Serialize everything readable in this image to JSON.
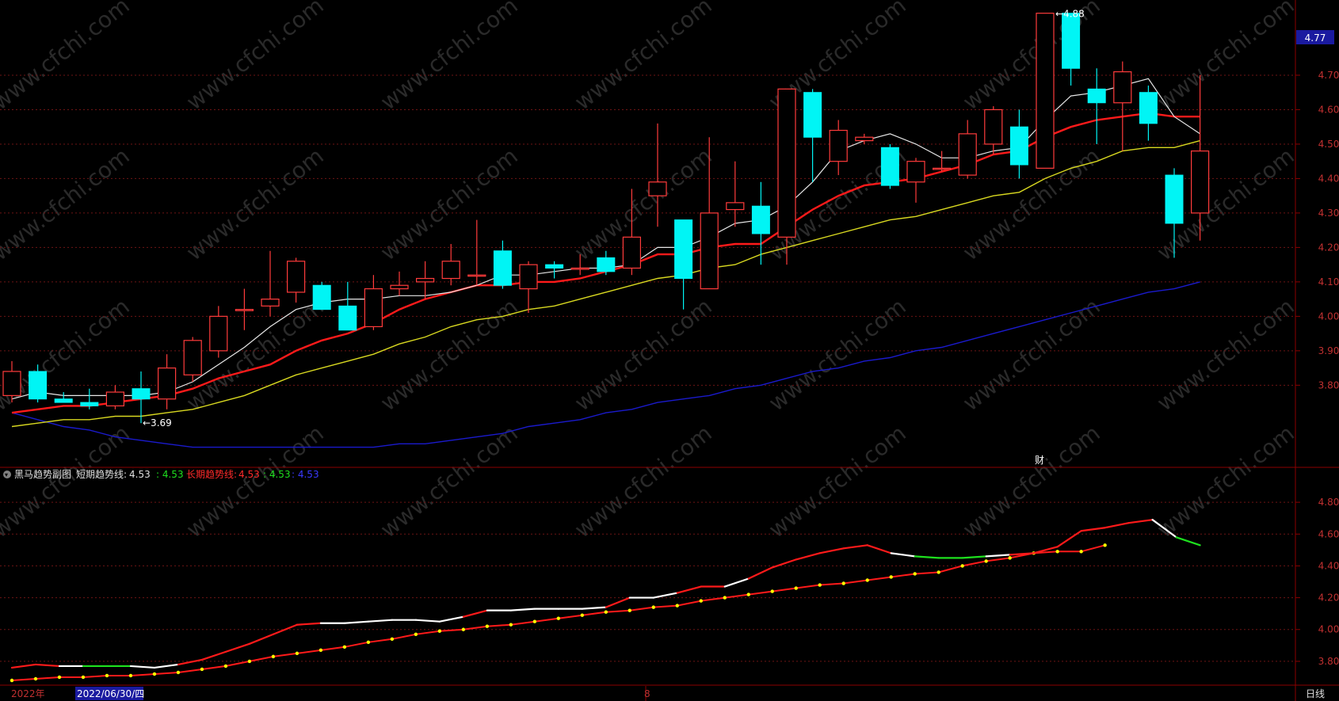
{
  "colors": {
    "bg": "#000000",
    "frame": "#8b0000",
    "grid": "#6e1414",
    "axis_text": "#c03030",
    "up": "#ff3b3b",
    "down": "#00f5f5",
    "ma_short": "#e6e6e6",
    "ma_mid": "#ff1a1a",
    "ma_long": "#d8d820",
    "ma_xlong": "#1a1acc",
    "sub_up": "#ff1a1a",
    "sub_flat": "#ffffff",
    "sub_down": "#1ee01e",
    "sub_dots": "#ffff00",
    "price_tag_bg": "#1a1aa0"
  },
  "watermark": "www.cfchi.com",
  "current_price_tag": "4.77",
  "main_panel": {
    "high_marker": "4.88",
    "low_marker": "3.69",
    "event_marker": "财"
  },
  "indicator_panel": {
    "collapse_icon": "chevron-down-icon",
    "title": "黑马趋势副图",
    "short_label": "短期趋势线:",
    "short_value": "4.53",
    "value_green": ": 4.53",
    "long_label": "长期趋势线:",
    "long_value": "4.53",
    "value_green2": ": 4.53",
    "value_blue": ": 4.53"
  },
  "time_axis": {
    "year_label": "2022年",
    "selected_date": "2022/06/30/四",
    "month_label": "8"
  },
  "period_button": "日线",
  "chart_data": [
    {
      "type": "candlestick",
      "y_axis_ticks": [
        "4.70",
        "4.60",
        "4.50",
        "4.40",
        "4.30",
        "4.20",
        "4.10",
        "4.00",
        "3.90",
        "3.80"
      ],
      "ylim": [
        3.58,
        4.9
      ],
      "candles": [
        {
          "o": 3.77,
          "h": 3.87,
          "l": 3.75,
          "c": 3.84
        },
        {
          "o": 3.84,
          "h": 3.86,
          "l": 3.75,
          "c": 3.76
        },
        {
          "o": 3.76,
          "h": 3.78,
          "l": 3.75,
          "c": 3.75
        },
        {
          "o": 3.75,
          "h": 3.79,
          "l": 3.73,
          "c": 3.74
        },
        {
          "o": 3.74,
          "h": 3.8,
          "l": 3.73,
          "c": 3.78
        },
        {
          "o": 3.79,
          "h": 3.84,
          "l": 3.69,
          "c": 3.76
        },
        {
          "o": 3.76,
          "h": 3.89,
          "l": 3.73,
          "c": 3.85
        },
        {
          "o": 3.83,
          "h": 3.94,
          "l": 3.81,
          "c": 3.93
        },
        {
          "o": 3.9,
          "h": 4.03,
          "l": 3.88,
          "c": 4.0
        },
        {
          "o": 4.02,
          "h": 4.08,
          "l": 3.96,
          "c": 4.02
        },
        {
          "o": 4.03,
          "h": 4.19,
          "l": 4.0,
          "c": 4.05
        },
        {
          "o": 4.07,
          "h": 4.17,
          "l": 4.04,
          "c": 4.16
        },
        {
          "o": 4.09,
          "h": 4.1,
          "l": 4.02,
          "c": 4.02
        },
        {
          "o": 4.03,
          "h": 4.1,
          "l": 3.98,
          "c": 3.96
        },
        {
          "o": 3.97,
          "h": 4.12,
          "l": 3.96,
          "c": 4.08
        },
        {
          "o": 4.08,
          "h": 4.13,
          "l": 4.06,
          "c": 4.09
        },
        {
          "o": 4.1,
          "h": 4.16,
          "l": 4.05,
          "c": 4.11
        },
        {
          "o": 4.11,
          "h": 4.21,
          "l": 4.09,
          "c": 4.16
        },
        {
          "o": 4.12,
          "h": 4.28,
          "l": 4.09,
          "c": 4.12
        },
        {
          "o": 4.19,
          "h": 4.22,
          "l": 4.08,
          "c": 4.09
        },
        {
          "o": 4.08,
          "h": 4.16,
          "l": 4.01,
          "c": 4.15
        },
        {
          "o": 4.15,
          "h": 4.16,
          "l": 4.11,
          "c": 4.14
        },
        {
          "o": 4.14,
          "h": 4.18,
          "l": 4.12,
          "c": 4.14
        },
        {
          "o": 4.17,
          "h": 4.19,
          "l": 4.12,
          "c": 4.13
        },
        {
          "o": 4.14,
          "h": 4.37,
          "l": 4.12,
          "c": 4.23
        },
        {
          "o": 4.35,
          "h": 4.56,
          "l": 4.26,
          "c": 4.39
        },
        {
          "o": 4.28,
          "h": 4.28,
          "l": 4.02,
          "c": 4.11
        },
        {
          "o": 4.08,
          "h": 4.52,
          "l": 4.08,
          "c": 4.3
        },
        {
          "o": 4.31,
          "h": 4.45,
          "l": 4.26,
          "c": 4.33
        },
        {
          "o": 4.32,
          "h": 4.39,
          "l": 4.15,
          "c": 4.24
        },
        {
          "o": 4.23,
          "h": 4.66,
          "l": 4.15,
          "c": 4.66
        },
        {
          "o": 4.65,
          "h": 4.66,
          "l": 4.39,
          "c": 4.52
        },
        {
          "o": 4.45,
          "h": 4.57,
          "l": 4.41,
          "c": 4.54
        },
        {
          "o": 4.51,
          "h": 4.53,
          "l": 4.5,
          "c": 4.52
        },
        {
          "o": 4.49,
          "h": 4.5,
          "l": 4.37,
          "c": 4.38
        },
        {
          "o": 4.39,
          "h": 4.46,
          "l": 4.33,
          "c": 4.45
        },
        {
          "o": 4.43,
          "h": 4.48,
          "l": 4.42,
          "c": 4.43
        },
        {
          "o": 4.41,
          "h": 4.57,
          "l": 4.4,
          "c": 4.53
        },
        {
          "o": 4.5,
          "h": 4.61,
          "l": 4.47,
          "c": 4.6
        },
        {
          "o": 4.55,
          "h": 4.6,
          "l": 4.4,
          "c": 4.44
        },
        {
          "o": 4.43,
          "h": 4.88,
          "l": 4.43,
          "c": 4.88
        },
        {
          "o": 4.88,
          "h": 4.88,
          "l": 4.67,
          "c": 4.72
        },
        {
          "o": 4.66,
          "h": 4.72,
          "l": 4.5,
          "c": 4.62
        },
        {
          "o": 4.62,
          "h": 4.74,
          "l": 4.48,
          "c": 4.71
        },
        {
          "o": 4.65,
          "h": 4.67,
          "l": 4.51,
          "c": 4.56
        },
        {
          "o": 4.41,
          "h": 4.43,
          "l": 4.17,
          "c": 4.27
        },
        {
          "o": 4.3,
          "h": 4.7,
          "l": 4.22,
          "c": 4.48
        }
      ],
      "ma_short": [
        3.76,
        3.78,
        3.77,
        3.77,
        3.77,
        3.77,
        3.78,
        3.81,
        3.86,
        3.91,
        3.97,
        4.02,
        4.04,
        4.05,
        4.05,
        4.06,
        4.06,
        4.07,
        4.09,
        4.12,
        4.12,
        4.13,
        4.14,
        4.14,
        4.15,
        4.2,
        4.2,
        4.23,
        4.27,
        4.28,
        4.32,
        4.39,
        4.48,
        4.51,
        4.53,
        4.5,
        4.46,
        4.46,
        4.48,
        4.49,
        4.57,
        4.64,
        4.65,
        4.67,
        4.69,
        4.58,
        4.53
      ],
      "ma_mid": [
        3.72,
        3.73,
        3.74,
        3.74,
        3.75,
        3.76,
        3.77,
        3.79,
        3.82,
        3.84,
        3.86,
        3.9,
        3.93,
        3.95,
        3.98,
        4.02,
        4.05,
        4.07,
        4.09,
        4.09,
        4.1,
        4.1,
        4.11,
        4.13,
        4.15,
        4.18,
        4.18,
        4.2,
        4.21,
        4.21,
        4.26,
        4.31,
        4.35,
        4.38,
        4.39,
        4.4,
        4.42,
        4.44,
        4.47,
        4.48,
        4.52,
        4.55,
        4.57,
        4.58,
        4.59,
        4.58,
        4.58
      ],
      "ma_long": [
        3.68,
        3.69,
        3.7,
        3.7,
        3.71,
        3.71,
        3.72,
        3.73,
        3.75,
        3.77,
        3.8,
        3.83,
        3.85,
        3.87,
        3.89,
        3.92,
        3.94,
        3.97,
        3.99,
        4.0,
        4.02,
        4.03,
        4.05,
        4.07,
        4.09,
        4.11,
        4.12,
        4.14,
        4.15,
        4.18,
        4.2,
        4.22,
        4.24,
        4.26,
        4.28,
        4.29,
        4.31,
        4.33,
        4.35,
        4.36,
        4.4,
        4.43,
        4.45,
        4.48,
        4.49,
        4.49,
        4.51
      ],
      "ma_xlong": [
        3.72,
        3.7,
        3.68,
        3.67,
        3.65,
        3.64,
        3.63,
        3.62,
        3.62,
        3.62,
        3.62,
        3.62,
        3.62,
        3.62,
        3.62,
        3.63,
        3.63,
        3.64,
        3.65,
        3.66,
        3.68,
        3.69,
        3.7,
        3.72,
        3.73,
        3.75,
        3.76,
        3.77,
        3.79,
        3.8,
        3.82,
        3.84,
        3.85,
        3.87,
        3.88,
        3.9,
        3.91,
        3.93,
        3.95,
        3.97,
        3.99,
        4.01,
        4.03,
        4.05,
        4.07,
        4.08,
        4.1
      ]
    },
    {
      "type": "line",
      "y_axis_ticks": [
        "4.80",
        "4.60",
        "4.40",
        "4.20",
        "4.00",
        "3.80"
      ],
      "ylim": [
        3.69,
        4.92
      ],
      "series": [
        {
          "name": "短期趋势线",
          "values": [
            3.76,
            3.78,
            3.77,
            3.77,
            3.77,
            3.77,
            3.76,
            3.78,
            3.81,
            3.86,
            3.91,
            3.97,
            4.03,
            4.04,
            4.04,
            4.05,
            4.06,
            4.06,
            4.05,
            4.08,
            4.12,
            4.12,
            4.13,
            4.13,
            4.13,
            4.14,
            4.2,
            4.2,
            4.23,
            4.27,
            4.27,
            4.32,
            4.39,
            4.44,
            4.48,
            4.51,
            4.53,
            4.48,
            4.46,
            4.45,
            4.45,
            4.46,
            4.47,
            4.48,
            4.52,
            4.62,
            4.64,
            4.67,
            4.69,
            4.58,
            4.53
          ]
        },
        {
          "name": "长期趋势线",
          "values": [
            3.68,
            3.69,
            3.7,
            3.7,
            3.71,
            3.71,
            3.72,
            3.73,
            3.75,
            3.77,
            3.8,
            3.83,
            3.85,
            3.87,
            3.89,
            3.92,
            3.94,
            3.97,
            3.99,
            4.0,
            4.02,
            4.03,
            4.05,
            4.07,
            4.09,
            4.11,
            4.12,
            4.14,
            4.15,
            4.18,
            4.2,
            4.22,
            4.24,
            4.26,
            4.28,
            4.29,
            4.31,
            4.33,
            4.35,
            4.36,
            4.4,
            4.43,
            4.45,
            4.48,
            4.49,
            4.49,
            4.53
          ]
        }
      ],
      "trend_segments": [
        "up",
        "up",
        "flat",
        "down",
        "down",
        "flat",
        "flat",
        "up",
        "up",
        "up",
        "up",
        "up",
        "up",
        "flat",
        "flat",
        "flat",
        "flat",
        "flat",
        "flat",
        "up",
        "flat",
        "flat",
        "flat",
        "flat",
        "flat",
        "up",
        "flat",
        "flat",
        "up",
        "up",
        "flat",
        "up",
        "up",
        "up",
        "up",
        "up",
        "up",
        "flat",
        "down",
        "down",
        "down",
        "flat",
        "up",
        "up",
        "up",
        "up",
        "up",
        "up",
        "flat",
        "down"
      ]
    }
  ]
}
